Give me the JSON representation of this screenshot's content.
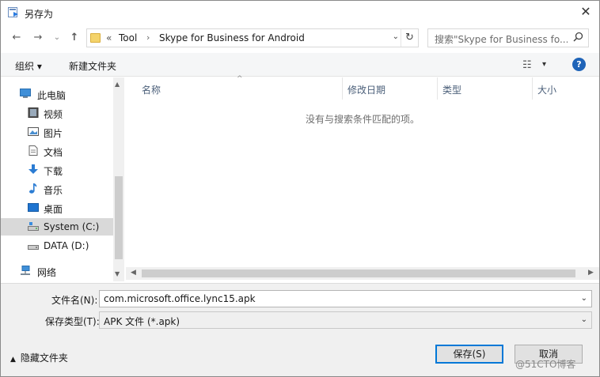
{
  "window": {
    "title": "另存为",
    "close_glyph": "✕"
  },
  "nav_buttons": {
    "back": "←",
    "forward": "→",
    "recent": "⌄",
    "up": "↑"
  },
  "address": {
    "prefix": "«",
    "breadcrumb": [
      "Tool",
      "Skype for Business for Android"
    ],
    "separator": "›",
    "dropdown": "⌄",
    "refresh": "↻"
  },
  "search": {
    "placeholder": "搜索\"Skype for Business fo...",
    "icon": "search-icon"
  },
  "toolbar": {
    "organize": "组织 ▾",
    "new_folder": "新建文件夹",
    "view_glyph": "☷",
    "view_drop": "▾",
    "help": "?"
  },
  "sidebar": {
    "items": [
      {
        "label": "此电脑",
        "icon": "computer-icon"
      },
      {
        "label": "视频",
        "icon": "video-icon"
      },
      {
        "label": "图片",
        "icon": "pictures-icon"
      },
      {
        "label": "文档",
        "icon": "documents-icon"
      },
      {
        "label": "下载",
        "icon": "download-icon"
      },
      {
        "label": "音乐",
        "icon": "music-icon"
      },
      {
        "label": "桌面",
        "icon": "desktop-icon"
      },
      {
        "label": "System (C:)",
        "icon": "drive-icon",
        "selected": true
      },
      {
        "label": "DATA (D:)",
        "icon": "drive-icon"
      },
      {
        "label": "网络",
        "icon": "network-icon"
      }
    ]
  },
  "file_list": {
    "columns": [
      "名称",
      "修改日期",
      "类型",
      "大小"
    ],
    "sort_glyph": "^",
    "empty_message": "没有与搜索条件匹配的项。"
  },
  "form": {
    "filename_label": "文件名(N):",
    "filename_value": "com.microsoft.office.lync15.apk",
    "filetype_label": "保存类型(T):",
    "filetype_value": "APK 文件 (*.apk)",
    "hide_folders": "隐藏文件夹",
    "save": "保存(S)",
    "cancel": "取消"
  },
  "watermark": "@51CTO博客",
  "colors": {
    "accent": "#0078d7",
    "help": "#1f64b8",
    "selected": "#d9d9d9",
    "header_text": "#4c607a"
  }
}
